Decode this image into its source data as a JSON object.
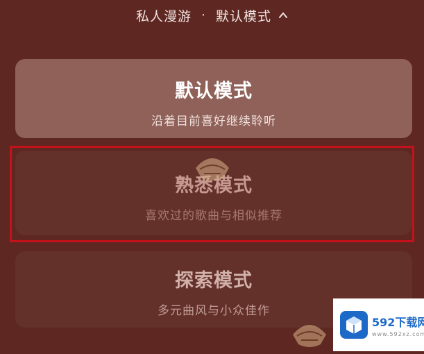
{
  "header": {
    "title": "私人漫游",
    "separator": "·",
    "current_mode": "默认模式"
  },
  "modes": [
    {
      "title": "默认模式",
      "desc": "沿着目前喜好继续聆听",
      "selected": true
    },
    {
      "title": "熟悉模式",
      "desc": "喜欢过的歌曲与相似推荐",
      "highlighted": true
    },
    {
      "title": "探索模式",
      "desc": "多元曲风与小众佳作"
    }
  ],
  "watermark": {
    "site_name": "592下载网",
    "site_domain": "www.592xz.com"
  },
  "colors": {
    "background": "#5e2721",
    "selected_card": "#906158",
    "card": "#64302a",
    "highlight_border": "#c3121c"
  },
  "icons": {
    "header_toggle": "chevron-up-icon",
    "watermark_logo": "box-logo-icon"
  }
}
